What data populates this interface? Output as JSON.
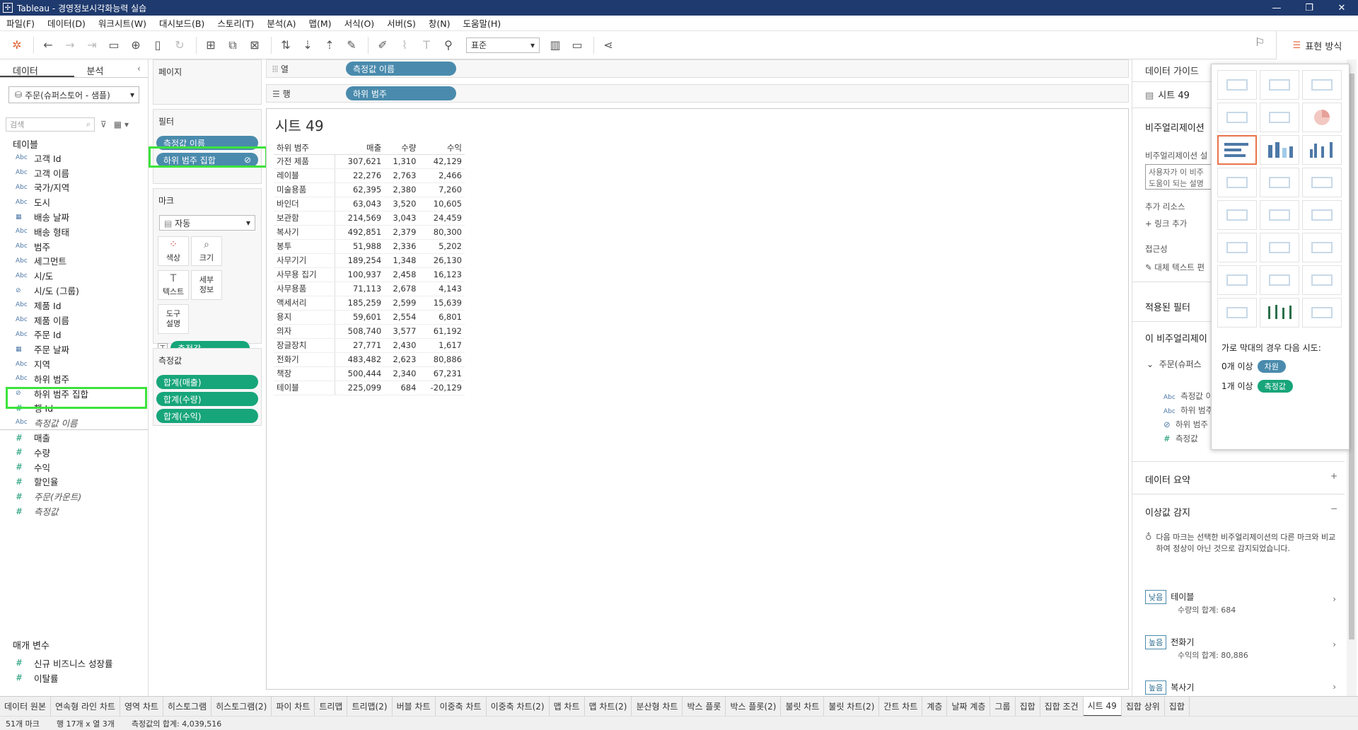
{
  "window": {
    "title": "Tableau - 경영정보시각화능력 실습",
    "controls": [
      "—",
      "❐",
      "✕"
    ]
  },
  "menu": [
    "파일(F)",
    "데이터(D)",
    "워크시트(W)",
    "대시보드(B)",
    "스토리(T)",
    "분석(A)",
    "맵(M)",
    "서식(O)",
    "서버(S)",
    "창(N)",
    "도움말(H)"
  ],
  "toolbar": {
    "fit_select": "표준",
    "showme_label": "표현 방식"
  },
  "left": {
    "tab_data": "데이터",
    "tab_analysis": "분석",
    "datasource": "주문(슈퍼스토어 - 샘플)",
    "search_placeholder": "검색",
    "tables_header": "테이블",
    "fields": [
      {
        "icon": "Abc",
        "name": "고객 Id",
        "type": "dim"
      },
      {
        "icon": "Abc",
        "name": "고객 이름",
        "type": "dim"
      },
      {
        "icon": "Abc",
        "name": "국가/지역",
        "type": "dim"
      },
      {
        "icon": "Abc",
        "name": "도시",
        "type": "dim"
      },
      {
        "icon": "▦",
        "name": "배송 날짜",
        "type": "dim"
      },
      {
        "icon": "Abc",
        "name": "배송 형태",
        "type": "dim"
      },
      {
        "icon": "Abc",
        "name": "범주",
        "type": "dim"
      },
      {
        "icon": "Abc",
        "name": "세그먼트",
        "type": "dim"
      },
      {
        "icon": "Abc",
        "name": "시/도",
        "type": "dim"
      },
      {
        "icon": "⊘",
        "name": "시/도 (그룹)",
        "type": "dim"
      },
      {
        "icon": "Abc",
        "name": "제품 Id",
        "type": "dim"
      },
      {
        "icon": "Abc",
        "name": "제품 이름",
        "type": "dim"
      },
      {
        "icon": "Abc",
        "name": "주문 Id",
        "type": "dim"
      },
      {
        "icon": "▦",
        "name": "주문 날짜",
        "type": "dim"
      },
      {
        "icon": "Abc",
        "name": "지역",
        "type": "dim"
      },
      {
        "icon": "Abc",
        "name": "하위 범주",
        "type": "dim"
      },
      {
        "icon": "⊘",
        "name": "하위 범주 집합",
        "type": "dim"
      },
      {
        "icon": "#",
        "name": "행 Id",
        "type": "dim"
      },
      {
        "icon": "Abc",
        "name": "측정값 이름",
        "type": "dim",
        "italic": true
      },
      {
        "icon": "#",
        "name": "매출",
        "type": "mea"
      },
      {
        "icon": "#",
        "name": "수량",
        "type": "mea"
      },
      {
        "icon": "#",
        "name": "수익",
        "type": "mea"
      },
      {
        "icon": "#",
        "name": "할인율",
        "type": "mea"
      },
      {
        "icon": "#",
        "name": "주문(카운트)",
        "type": "mea",
        "italic": true
      },
      {
        "icon": "#",
        "name": "측정값",
        "type": "mea",
        "italic": true
      }
    ],
    "params_header": "매개 변수",
    "params": [
      "신규 비즈니스 성장률",
      "이탈률"
    ]
  },
  "cards": {
    "pages": "페이지",
    "filters": "필터",
    "filter_pills": [
      "측정값 이름",
      "하위 범주 집합"
    ],
    "marks": "마크",
    "mark_type": "자동",
    "mark_buttons": [
      {
        "icon": "⁘",
        "label": "색상"
      },
      {
        "icon": "⌕",
        "label": "크기"
      },
      {
        "icon": "T",
        "label": "텍스트"
      },
      {
        "icon": "",
        "label": "세부\n정보"
      },
      {
        "icon": "",
        "label": "도구\n설명"
      }
    ],
    "mark_text_pill": "측정값",
    "measures": "측정값",
    "measure_pills": [
      "합계(매출)",
      "합계(수량)",
      "합계(수익)"
    ]
  },
  "shelves": {
    "columns_label": "열",
    "columns_pill": "측정값 이름",
    "rows_label": "행",
    "rows_pill": "하위 범주"
  },
  "sheet": {
    "title": "시트 49",
    "headers": [
      "하위 범주",
      "매출",
      "수량",
      "수익"
    ],
    "rows": [
      [
        "가전 제품",
        "307,621",
        "1,310",
        "42,129"
      ],
      [
        "레이블",
        "22,276",
        "2,763",
        "2,466"
      ],
      [
        "미술용품",
        "62,395",
        "2,380",
        "7,260"
      ],
      [
        "바인더",
        "63,043",
        "3,520",
        "10,605"
      ],
      [
        "보관함",
        "214,569",
        "3,043",
        "24,459"
      ],
      [
        "복사기",
        "492,851",
        "2,379",
        "80,300"
      ],
      [
        "봉투",
        "51,988",
        "2,336",
        "5,202"
      ],
      [
        "사무기기",
        "189,254",
        "1,348",
        "26,130"
      ],
      [
        "사무용 집기",
        "100,937",
        "2,458",
        "16,123"
      ],
      [
        "사무용품",
        "71,113",
        "2,678",
        "4,143"
      ],
      [
        "액세서리",
        "185,259",
        "2,599",
        "15,639"
      ],
      [
        "용지",
        "59,601",
        "2,554",
        "6,801"
      ],
      [
        "의자",
        "508,740",
        "3,577",
        "61,192"
      ],
      [
        "장글장치",
        "27,771",
        "2,430",
        "1,617"
      ],
      [
        "전화기",
        "483,482",
        "2,623",
        "80,886"
      ],
      [
        "책장",
        "500,444",
        "2,340",
        "67,231"
      ],
      [
        "테이블",
        "225,099",
        "684",
        "-20,129"
      ]
    ]
  },
  "right": {
    "title": "데이터 가이드",
    "sheet_name": "시트 49",
    "viz_header": "비주얼리제이션",
    "viz_desc_label": "비주얼리제이션 설",
    "viz_desc_placeholder": "사용자가 이 비주\n도움이 되는 설명",
    "resources_label": "추가 리소스",
    "add_link": "링크 추가",
    "access_label": "접근성",
    "alt_text": "대체 텍스트 편",
    "filters_applied": "적용된 필터",
    "this_viz": "이 비주얼리제이",
    "ds_item": "주문(슈퍼스",
    "viz_fields": [
      "측정값 이",
      "하위 범주",
      "하위 범주",
      "측정값"
    ],
    "data_summary": "데이터 요약",
    "outliers": "이상값 감지",
    "outliers_desc": "다음 마크는 선택한 비주얼리제이션의 다른 마크와 비교하여 정상이 아닌 것으로 감지되었습니다.",
    "outlier_items": [
      {
        "badge": "낮음",
        "title": "테이블",
        "detail": "수량의 합계: 684"
      },
      {
        "badge": "높음",
        "title": "전화기",
        "detail": "수익의 합계: 80,886"
      },
      {
        "badge": "높음",
        "title": "복사기",
        "detail": ""
      }
    ]
  },
  "showme": {
    "hint_title": "가로 막대의 경우 다음 시도:",
    "hint_row1_count": "0개 이상",
    "hint_row1_pill": "차원",
    "hint_row2_count": "1개 이상",
    "hint_row2_pill": "측정값"
  },
  "tabs": [
    "데이터 원본",
    "연속형 라인 차트",
    "영역 차트",
    "히스토그램",
    "히스토그램(2)",
    "파이 차트",
    "트리맵",
    "트리맵(2)",
    "버블 차트",
    "이중축 차트",
    "이중축 차트(2)",
    "맵 차트",
    "맵 차트(2)",
    "분산형 차트",
    "박스 플롯",
    "박스 플롯(2)",
    "불릿 차트",
    "불릿 차트(2)",
    "간트 차트",
    "계층",
    "날짜 계층",
    "그룹",
    "집합",
    "집합 조건",
    "시트 49",
    "집합 상위",
    "집합"
  ],
  "status": {
    "marks": "51개 마크",
    "rows_cols": "행 17개 x 열 3개",
    "sum": "측정값의 합계: 4,039,516"
  },
  "colors": {
    "titlebar": "#1f3a6e",
    "dim_pill": "#4a8bad",
    "mea_pill": "#17a57a",
    "highlight": "#3ce33c",
    "selected_chart": "#e8744a"
  }
}
